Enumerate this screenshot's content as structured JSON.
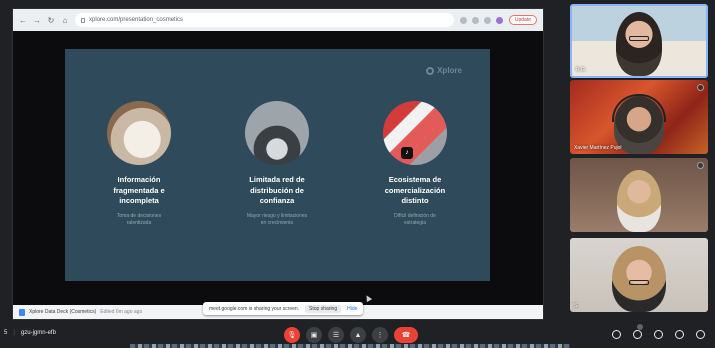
{
  "browser": {
    "url": "xplore.com/presentation_cosmetics",
    "update_label": "Update"
  },
  "slide": {
    "logo": "Xplore",
    "columns": [
      {
        "title_lines": [
          "Información",
          "fragmentada e",
          "incompleta"
        ],
        "subtitle_lines": [
          "Toma de decisiones",
          "ralentizada"
        ]
      },
      {
        "title_lines": [
          "Limitada red de",
          "distribución de",
          "confianza"
        ],
        "subtitle_lines": [
          "Mayor riesgo y limitaciones",
          "en crecimiento"
        ]
      },
      {
        "title_lines": [
          "Ecosistema de",
          "comercialización",
          "distinto"
        ],
        "subtitle_lines": [
          "Difícil definición de",
          "estrategia"
        ]
      }
    ]
  },
  "page_footer": {
    "doc_title": "Xplore Data Deck (Cosmetics)",
    "edited": "Edited 6m ago ago"
  },
  "share_banner": {
    "text": "meet.google.com is sharing your screen.",
    "stop_label": "Stop sharing",
    "hide_label": "Hide"
  },
  "participants": [
    {
      "name": "",
      "corner": "R.G."
    },
    {
      "name": "Xavier Martínez Pujol",
      "corner": ""
    },
    {
      "name": "",
      "corner": ""
    },
    {
      "name": "",
      "corner": "S."
    }
  ],
  "call_bar": {
    "meeting_code": "gzu-jgmn-efb",
    "time_fragment": "5"
  },
  "colors": {
    "slide_bg": "#2f4a5a",
    "end_call": "#ea4335",
    "mic_off": "#ea4335"
  }
}
